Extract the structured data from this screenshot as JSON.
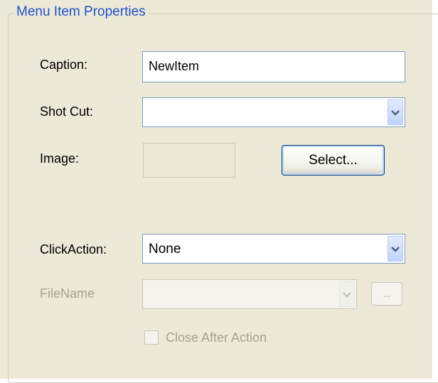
{
  "group": {
    "title": "Menu Item Properties"
  },
  "caption": {
    "label": "Caption:",
    "value": "NewItem"
  },
  "shortcut": {
    "label": "Shot Cut:",
    "value": ""
  },
  "image": {
    "label": "Image:",
    "select_button": "Select..."
  },
  "click_action": {
    "label": "ClickAction:",
    "value": "None"
  },
  "file_name": {
    "label": "FileName",
    "value": "",
    "browse_button": "..."
  },
  "close_after_action": {
    "label": "Close After Action",
    "checked": false
  },
  "icons": {
    "combo_arrow": "chevron-down-icon"
  },
  "colors": {
    "panel_background": "#ece9d8",
    "title_blue": "#2152c8",
    "disabled_text": "#a5a294",
    "field_border": "#7f9db9",
    "arrow_blue": "#4d6185"
  }
}
